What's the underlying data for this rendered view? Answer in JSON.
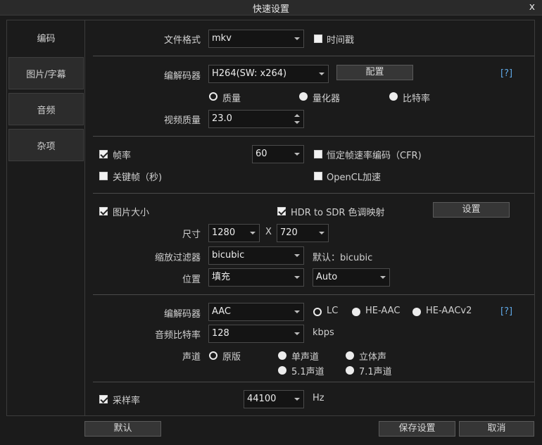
{
  "window": {
    "title": "快速设置",
    "close": "x"
  },
  "sidebar": {
    "items": [
      {
        "label": "编码"
      },
      {
        "label": "图片/字幕"
      },
      {
        "label": "音频"
      },
      {
        "label": "杂项"
      }
    ]
  },
  "file": {
    "format_label": "文件格式",
    "format_value": "mkv",
    "timestamp_label": "时间戳",
    "timestamp_checked": false
  },
  "video": {
    "codec_label": "编解码器",
    "codec_value": "H264(SW: x264)",
    "config_button": "配置",
    "help": "[?]",
    "modes": [
      {
        "label": "质量",
        "selected": true
      },
      {
        "label": "量化器",
        "selected": false
      },
      {
        "label": "比特率",
        "selected": false
      }
    ],
    "quality_label": "视频质量",
    "quality_value": "23.0"
  },
  "framerate": {
    "fps_label": "帧率",
    "fps_checked": true,
    "fps_value": "60",
    "cfr_label": "恒定帧速率编码（CFR)",
    "cfr_checked": false,
    "keyframe_label": "关键帧（秒)",
    "keyframe_checked": false,
    "opencl_label": "OpenCL加速",
    "opencl_checked": false
  },
  "picture": {
    "size_label": "图片大小",
    "size_checked": true,
    "hdr_label": "HDR to SDR 色调映射",
    "hdr_checked": true,
    "settings_button": "设置",
    "dim_label": "尺寸",
    "width": "1280",
    "x": "X",
    "height": "720",
    "filter_label": "缩放过滤器",
    "filter_value": "bicubic",
    "filter_default": "默认：bicubic",
    "position_label": "位置",
    "position_value": "填充",
    "position_auto": "Auto"
  },
  "audio": {
    "codec_label": "编解码器",
    "codec_value": "AAC",
    "profiles": [
      {
        "label": "LC",
        "selected": true
      },
      {
        "label": "HE-AAC",
        "selected": false
      },
      {
        "label": "HE-AACv2",
        "selected": false
      }
    ],
    "help": "[?]",
    "bitrate_label": "音频比特率",
    "bitrate_value": "128",
    "bitrate_unit": "kbps",
    "channel_label": "声道",
    "channels": [
      {
        "label": "原版",
        "selected": true
      },
      {
        "label": "单声道",
        "selected": false
      },
      {
        "label": "立体声",
        "selected": false
      },
      {
        "label": "5.1声道",
        "selected": false
      },
      {
        "label": "7.1声道",
        "selected": false
      }
    ]
  },
  "samplerate": {
    "label": "采样率",
    "checked": true,
    "value": "44100",
    "unit": "Hz"
  },
  "footer": {
    "default": "默认",
    "save": "保存设置",
    "cancel": "取消"
  }
}
